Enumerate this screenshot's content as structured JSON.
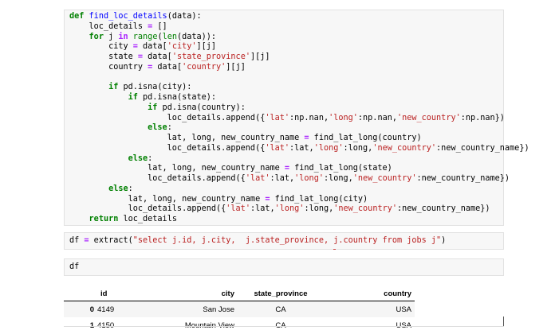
{
  "cells": {
    "code_cell_1": {
      "lines": [
        [
          "def",
          " ",
          "find_loc_details",
          "(data):"
        ],
        [
          "    loc_details ",
          "=",
          " []"
        ],
        [
          "    ",
          "for",
          " j ",
          "in",
          " ",
          "range",
          "(",
          "len",
          "(data)):"
        ],
        [
          "        city ",
          "=",
          " data[",
          "'city'",
          "][j]"
        ],
        [
          "        state ",
          "=",
          " data[",
          "'state_province'",
          "][j]"
        ],
        [
          "        country ",
          "=",
          " data[",
          "'country'",
          "][j]"
        ],
        [
          ""
        ],
        [
          "        ",
          "if",
          " pd.isna(city):"
        ],
        [
          "            ",
          "if",
          " pd.isna(state):"
        ],
        [
          "                ",
          "if",
          " pd.isna(country):"
        ],
        [
          "                    loc_details.append({",
          "'lat'",
          ":np.nan,",
          "'long'",
          ":np.nan,",
          "'new_country'",
          ":np.nan})"
        ],
        [
          "                ",
          "else",
          ":"
        ],
        [
          "                    lat, long, new_country_name ",
          "=",
          " find_lat_long(country)"
        ],
        [
          "                    loc_details.append({",
          "'lat'",
          ":lat,",
          "'long'",
          ":long,",
          "'new_country'",
          ":new_country_name})"
        ],
        [
          "            ",
          "else",
          ":"
        ],
        [
          "                lat, long, new_country_name ",
          "=",
          " find_lat_long(state)"
        ],
        [
          "                loc_details.append({",
          "'lat'",
          ":lat,",
          "'long'",
          ":long,",
          "'new_country'",
          ":new_country_name})"
        ],
        [
          "        ",
          "else",
          ":"
        ],
        [
          "            lat, long, new_country_name ",
          "=",
          " find_lat_long(city)"
        ],
        [
          "            loc_details.append({",
          "'lat'",
          ":lat,",
          "'long'",
          ":long,",
          "'new_country'",
          ":new_country_name})"
        ],
        [
          "    ",
          "return",
          " loc_details"
        ]
      ]
    },
    "code_cell_2": {
      "text_parts": [
        "df ",
        "=",
        " extract(",
        "\"select j.id, j.city,  j.state_province, j.country from jobs j\"",
        ")"
      ]
    },
    "code_cell_3": {
      "text": "df"
    }
  },
  "output_table": {
    "columns": [
      "",
      "id",
      "city",
      "state_province",
      "country"
    ],
    "rows": [
      [
        "0",
        "4149",
        "San Jose",
        "CA",
        "USA"
      ],
      [
        "1",
        "4150",
        "Mountain View",
        "CA",
        "USA"
      ]
    ]
  }
}
